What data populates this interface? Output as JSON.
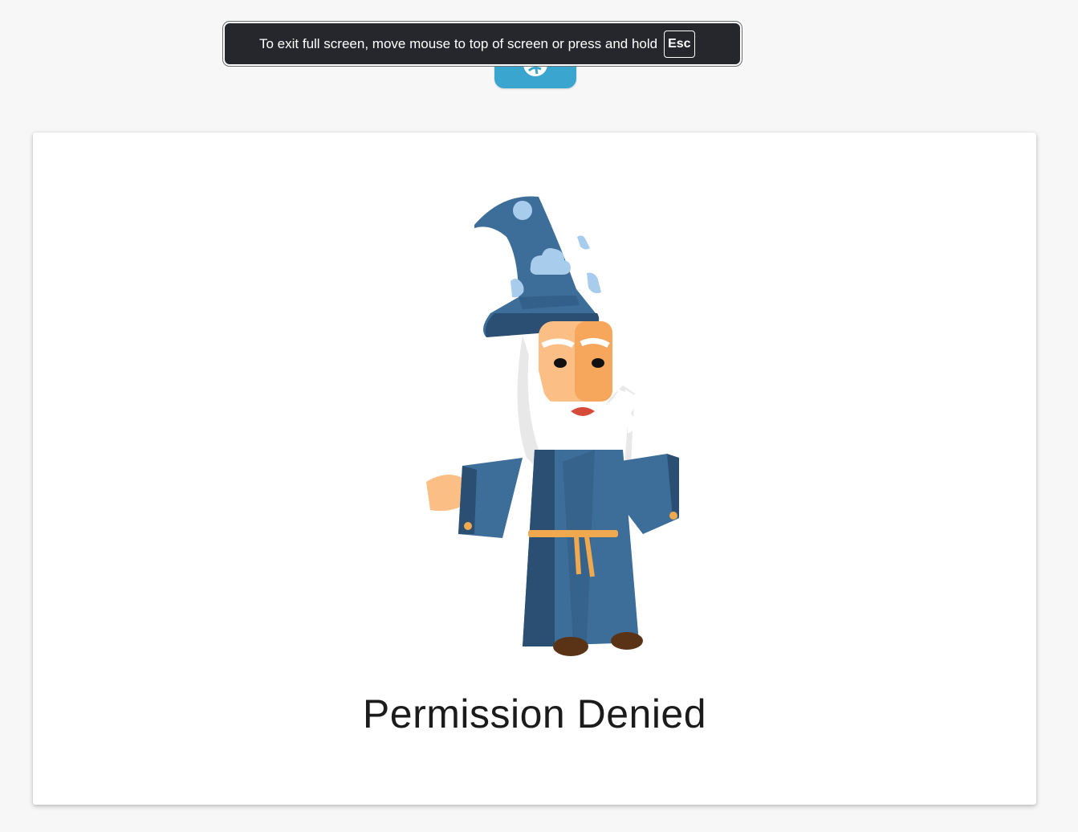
{
  "fullscreen_notice": {
    "message": "To exit full screen, move mouse to top of screen or press and hold",
    "key_label": "Esc"
  },
  "header": {
    "logo_icon": "globe-logo-icon"
  },
  "error_card": {
    "illustration": "wizard-illustration",
    "title": "Permission Denied"
  },
  "colors": {
    "page_background": "#f7f7f7",
    "logo_accent": "#3aa6cf",
    "wizard_robe": "#3d6e9a",
    "wizard_robe_dark": "#2a4f72",
    "wizard_belt": "#f0a94f",
    "wizard_skin": "#fbbf85",
    "title_text": "#1b1b1b"
  }
}
